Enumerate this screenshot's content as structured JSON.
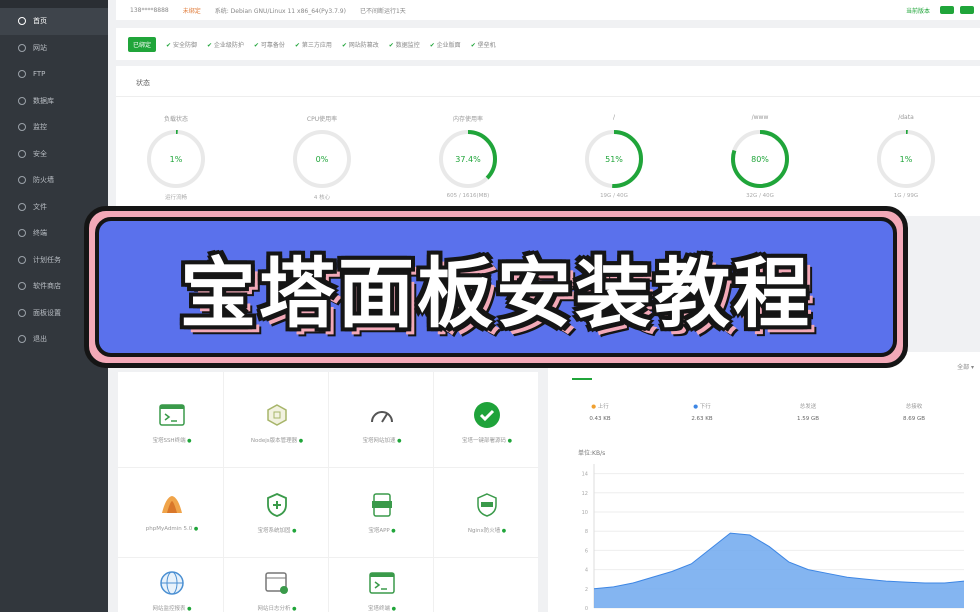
{
  "sidebar": {
    "items": [
      {
        "label": "首页",
        "active": true
      },
      {
        "label": "网站"
      },
      {
        "label": "FTP"
      },
      {
        "label": "数据库"
      },
      {
        "label": "监控"
      },
      {
        "label": "安全"
      },
      {
        "label": "防火墙"
      },
      {
        "label": "文件"
      },
      {
        "label": "终端"
      },
      {
        "label": "计划任务"
      },
      {
        "label": "软件商店"
      },
      {
        "label": "面板设置"
      },
      {
        "label": "退出"
      }
    ]
  },
  "topbar": {
    "user": "138****8888",
    "status": "未绑定",
    "system": "系统: Debian GNU/Linux 11 x86_64(Py3.7.9)",
    "uptime": "已不间断运行1天",
    "update": "当前版本"
  },
  "infobar": {
    "tag": "已绑定",
    "pills": [
      "安全防御",
      "企业级防护",
      "可靠备份",
      "第三方应用",
      "网站防篡改",
      "数据监控",
      "企业版面",
      "堡垒机"
    ]
  },
  "status": {
    "heading": "状态",
    "gauges": [
      {
        "label": "负载状态",
        "value": "1%",
        "percent": 1,
        "sub": "运行流畅"
      },
      {
        "label": "CPU使用率",
        "value": "0%",
        "percent": 0,
        "sub": "4 核心"
      },
      {
        "label": "内存使用率",
        "value": "37.4%",
        "percent": 37.4,
        "sub": "605 / 1616(MB)"
      },
      {
        "label": "/",
        "value": "51%",
        "percent": 51,
        "sub": "19G / 40G"
      },
      {
        "label": "/www",
        "value": "80%",
        "percent": 80,
        "sub": "32G / 40G"
      },
      {
        "label": "/data",
        "value": "1%",
        "percent": 1,
        "sub": "1G / 99G"
      }
    ]
  },
  "apps": [
    {
      "name": "宝塔SSH终端",
      "icon": "terminal-icon"
    },
    {
      "name": "Nodejs版本管理器",
      "icon": "nodejs-icon"
    },
    {
      "name": "宝塔网站加速",
      "icon": "speed-icon"
    },
    {
      "name": "宝塔一键部署源码",
      "icon": "check-icon"
    },
    {
      "name": "phpMyAdmin 5.0",
      "icon": "phpmyadmin-icon"
    },
    {
      "name": "宝塔系统加固",
      "icon": "shield-icon"
    },
    {
      "name": "宝塔APP",
      "icon": "app-icon"
    },
    {
      "name": "Nginx防火墙",
      "icon": "firewall-icon"
    },
    {
      "name": "网站监控报表",
      "icon": "globe-icon"
    },
    {
      "name": "网站日志分析",
      "icon": "log-icon"
    },
    {
      "name": "宝塔终端",
      "icon": "terminal-icon"
    }
  ],
  "traffic": {
    "select": "全部",
    "stats": [
      {
        "label": "上行",
        "value": "0.43 KB"
      },
      {
        "label": "下行",
        "value": "2.63 KB"
      },
      {
        "label": "总发送",
        "value": "1.59 GB"
      },
      {
        "label": "总接收",
        "value": "8.69 GB"
      }
    ],
    "unit_label": "单位:KB/s"
  },
  "chart_data": {
    "type": "area",
    "title": "",
    "ylabel": "单位:KB/s",
    "y_ticks": [
      0,
      2,
      4,
      6,
      8,
      10,
      12,
      14
    ],
    "ylim": [
      0,
      15
    ],
    "series": [
      {
        "values": [
          2,
          2.2,
          2.6,
          3.2,
          3.8,
          4.6,
          6.2,
          7.8,
          7.6,
          6.4,
          4.8,
          4.0,
          3.6,
          3.2,
          3.0,
          2.8,
          2.7,
          2.6,
          2.6,
          2.8
        ]
      }
    ],
    "colors": {
      "fill": "#6ea8ef",
      "line": "#3d86e4"
    }
  },
  "banner": {
    "title": "宝塔面板安装教程"
  }
}
